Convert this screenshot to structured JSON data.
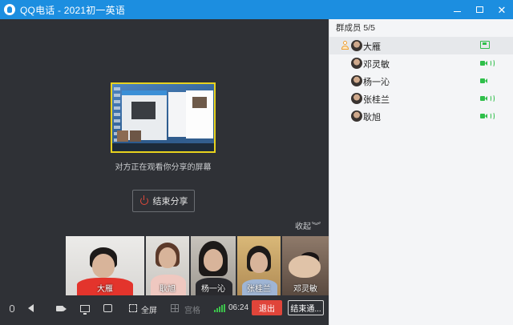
{
  "window": {
    "title": "QQ电话 - 2021初一英语"
  },
  "share": {
    "caption": "对方正在观看你分享的屏幕",
    "end_button": "结束分享"
  },
  "video_strip": {
    "collapse_label": "收起",
    "participants": [
      {
        "name": "大雁"
      },
      {
        "name": "耿旭"
      },
      {
        "name": "杨一沁"
      },
      {
        "name": "张桂兰"
      },
      {
        "name": "邓灵敏"
      }
    ]
  },
  "toolbar": {
    "fullscreen_label": "全屏",
    "grid_label": "宫格",
    "timer": "06:24",
    "exit_label": "退出",
    "end_all_label": "结束通..."
  },
  "panel": {
    "header": "群成员 5/5",
    "members": [
      {
        "name": "大雁",
        "role": "host",
        "status_icon": "share-screen-icon"
      },
      {
        "name": "邓灵敏",
        "role": "guest",
        "status_icon": "voice-cam-icon"
      },
      {
        "name": "杨一沁",
        "role": "guest",
        "status_icon": "voice-cam-icon"
      },
      {
        "name": "张桂兰",
        "role": "guest",
        "status_icon": "voice-cam-icon"
      },
      {
        "name": "耿旭",
        "role": "guest",
        "status_icon": "voice-cam-icon"
      }
    ]
  },
  "colors": {
    "titlebar": "#1c8ee0",
    "stage_bg": "#2f3136",
    "exit_red": "#e0453a",
    "status_green": "#2fbf4a",
    "share_border": "#e8d21e"
  }
}
